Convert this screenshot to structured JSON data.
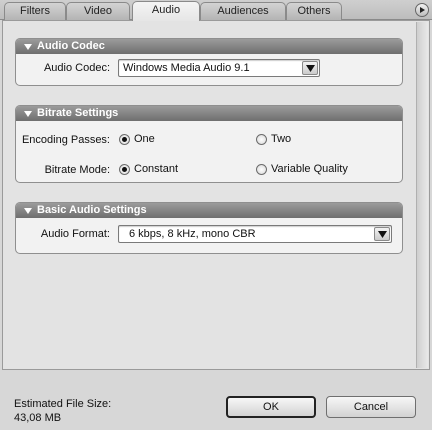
{
  "tabs": [
    {
      "label": "Filters",
      "active": false
    },
    {
      "label": "Video",
      "active": false
    },
    {
      "label": "Audio",
      "active": true
    },
    {
      "label": "Audiences",
      "active": false
    },
    {
      "label": "Others",
      "active": false
    }
  ],
  "audio_codec": {
    "header": "Audio Codec",
    "codec_label": "Audio Codec:",
    "codec_value": "Windows Media Audio 9.1"
  },
  "bitrate": {
    "header": "Bitrate Settings",
    "passes_label": "Encoding Passes:",
    "passes_options": [
      {
        "label": "One",
        "selected": true
      },
      {
        "label": "Two",
        "selected": false
      }
    ],
    "mode_label": "Bitrate Mode:",
    "mode_options": [
      {
        "label": "Constant",
        "selected": true
      },
      {
        "label": "Variable Quality",
        "selected": false
      }
    ]
  },
  "basic_audio": {
    "header": "Basic Audio Settings",
    "format_label": "Audio Format:",
    "format_value": "6 kbps,  8 kHz, mono CBR"
  },
  "footer": {
    "size_label": "Estimated File Size:",
    "size_value": "43,08 MB",
    "ok_label": "OK",
    "cancel_label": "Cancel"
  }
}
